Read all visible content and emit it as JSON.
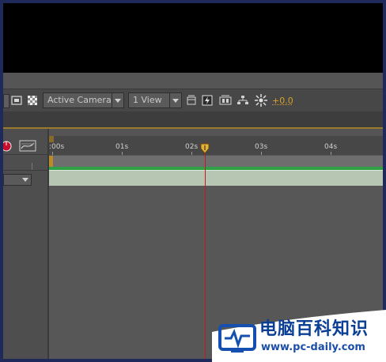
{
  "toolbar": {
    "camera_dropdown": "Active Camera",
    "view_dropdown": "1 View",
    "exposure_value": "+0.0"
  },
  "timeline": {
    "time_labels": [
      ":00s",
      "01s",
      "02s",
      "03s",
      "04s"
    ],
    "playhead_time_seconds": 2.2
  },
  "watermark": {
    "title": "电脑百科知识",
    "url": "www.pc-daily.com"
  },
  "colors": {
    "accent": "#d8a030",
    "playhead": "#c41a1a",
    "layer_bar": "#b7c5b3",
    "layer_top": "#30a046",
    "watermark_blue": "#0a3f95"
  }
}
